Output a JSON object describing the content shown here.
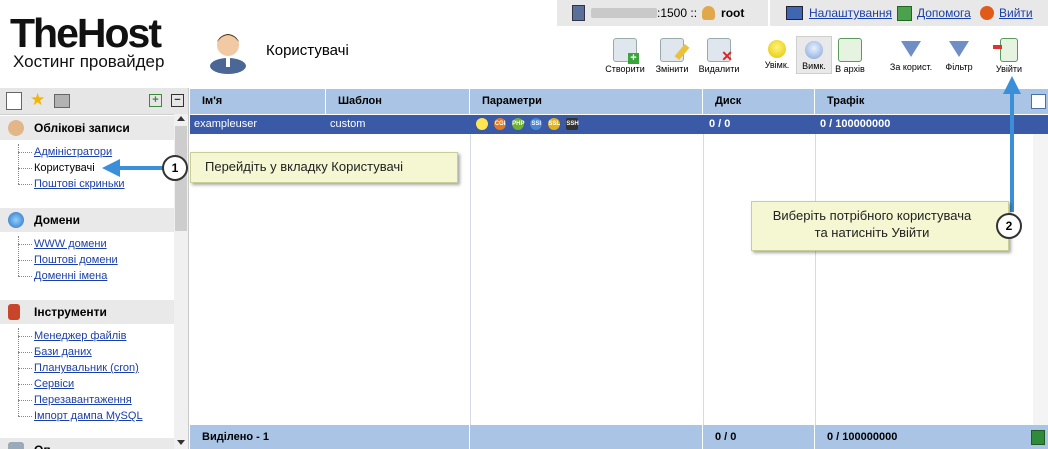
{
  "topbar": {
    "host_suffix": ":1500 ::",
    "user": "root",
    "settings": "Налаштування",
    "help": "Допомога",
    "logout": "Вийти"
  },
  "logo": {
    "big": "TheHost",
    "small": "Хостинг провайдер"
  },
  "page_title": "Користувачі",
  "toolbar": {
    "create": "Створити",
    "edit": "Змінити",
    "delete": "Видалити",
    "enable": "Увімк.",
    "disable": "Вимк.",
    "archive": "В архів",
    "by_user": "За корист.",
    "filter": "Фільтр",
    "enter": "Увійти"
  },
  "sidebar": {
    "sections": [
      {
        "title": "Облікові записи",
        "items": [
          "Адміністратори",
          "Користувачі",
          "Поштові скриньки"
        ]
      },
      {
        "title": "Домени",
        "items": [
          "WWW домени",
          "Поштові домени",
          "Доменні імена"
        ]
      },
      {
        "title": "Інструменти",
        "items": [
          "Менеджер файлів",
          "Бази даних",
          "Планувальник (cron)",
          "Сервіси",
          "Перезавантаження",
          "Імпорт дампа MySQL"
        ]
      }
    ],
    "partial_section_title": "Оп"
  },
  "table": {
    "headers": [
      "Ім'я",
      "Шаблон",
      "Параметри",
      "Диск",
      "Трафік"
    ],
    "rows": [
      {
        "name": "exampleuser",
        "template": "custom",
        "params": [
          "CGI",
          "PHP",
          "SSI",
          "SSL",
          "SSH"
        ],
        "disk": "0 / 0",
        "traffic": "0 / 100000000"
      }
    ],
    "footer": {
      "label": "Виділено - 1",
      "disk": "0 / 0",
      "traffic": "0 / 100000000"
    }
  },
  "callouts": {
    "one": {
      "number": "1",
      "text": "Перейдіть у вкладку Користувачі"
    },
    "two": {
      "number": "2",
      "line1": "Виберіть потрібного користувача",
      "line2": "та натисніть Увійти"
    }
  },
  "colors": {
    "accent": "#3a5aa8",
    "header_bg": "#a9c4e4",
    "callout_bg": "#f4f7d2"
  }
}
